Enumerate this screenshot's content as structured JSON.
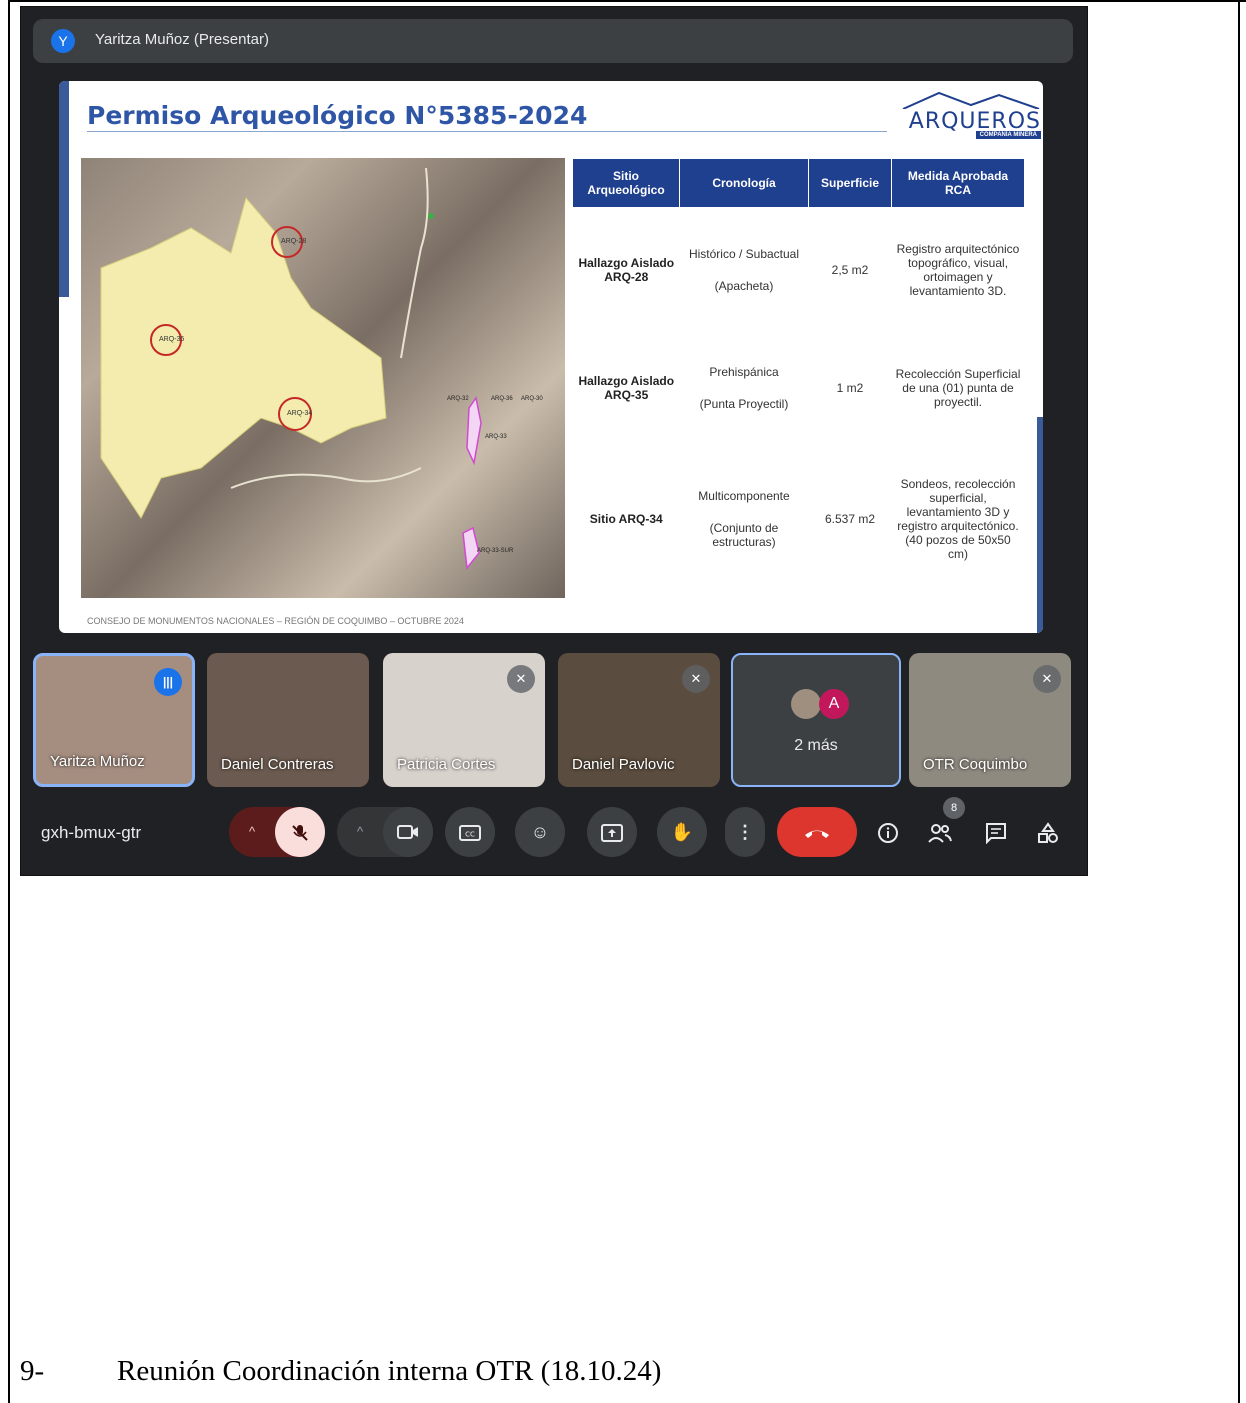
{
  "meeting": {
    "presenter_label": "Yaritza Muñoz (Presentar)",
    "presenter_initial": "Y",
    "meeting_code": "gxh-bmux-gtr",
    "participants_count": "8"
  },
  "slide": {
    "title": "Permiso Arqueológico N°5385-2024",
    "logo_text": "ARQUEROS",
    "logo_subtext": "COMPAÑÍA MINERA",
    "footer": "CONSEJO DE MONUMENTOS NACIONALES – REGIÓN DE COQUIMBO – OCTUBRE 2024",
    "map_labels": [
      "ARQ-28",
      "ARQ-35",
      "ARQ-34",
      "ARQ-32",
      "ARQ-36",
      "ARQ-30",
      "ARQ-33",
      "ARQ-33-SUR"
    ],
    "table": {
      "headers": [
        "Sitio Arqueológico",
        "Cronología",
        "Superficie",
        "Medida Aprobada RCA"
      ],
      "rows": [
        {
          "site": "Hallazgo Aislado ARQ-28",
          "chronology": "Histórico / Subactual",
          "chronology_note": "(Apacheta)",
          "surface": "2,5 m2",
          "measure": "Registro arquitectónico topográfico, visual, ortoimagen y levantamiento 3D."
        },
        {
          "site": "Hallazgo Aislado ARQ-35",
          "chronology": "Prehispánica",
          "chronology_note": "(Punta Proyectil)",
          "surface": "1 m2",
          "measure": "Recolección Superficial de una (01) punta de proyectil."
        },
        {
          "site": "Sitio ARQ-34",
          "chronology": "Multicomponente",
          "chronology_note": "(Conjunto de estructuras)",
          "surface": "6.537 m2",
          "measure": "Sondeos, recolección superficial, levantamiento 3D y registro arquitectónico. (40 pozos de 50x50 cm)"
        }
      ]
    }
  },
  "participants": [
    {
      "name": "Yaritza Muñoz",
      "state": "speaking"
    },
    {
      "name": "Daniel Contreras",
      "state": ""
    },
    {
      "name": "Patricia Cortes",
      "state": "muted"
    },
    {
      "name": "Daniel Pavlovic",
      "state": "muted"
    },
    {
      "name": "OTR Coquimbo",
      "state": "muted"
    }
  ],
  "more_tile": {
    "label": "2 más",
    "initial": "A"
  },
  "icons": {
    "mic": "mic-off-icon",
    "camera": "camera-icon",
    "captions": "captions-icon",
    "emoji": "emoji-icon",
    "present": "present-icon",
    "hand": "raise-hand-icon",
    "more": "more-options-icon",
    "end": "end-call-icon",
    "info": "info-icon",
    "people": "people-icon",
    "chat": "chat-icon",
    "activities": "activities-icon"
  },
  "colors": {
    "meet_bg": "#202124",
    "slide_title": "#2f56a6",
    "table_header": "#1f3f8f",
    "end_call": "#dc362e",
    "speaking_border": "#8ab4f8"
  },
  "document": {
    "caption_number": "9-",
    "caption_text": "Reunión Coordinación interna OTR (18.10.24)"
  }
}
